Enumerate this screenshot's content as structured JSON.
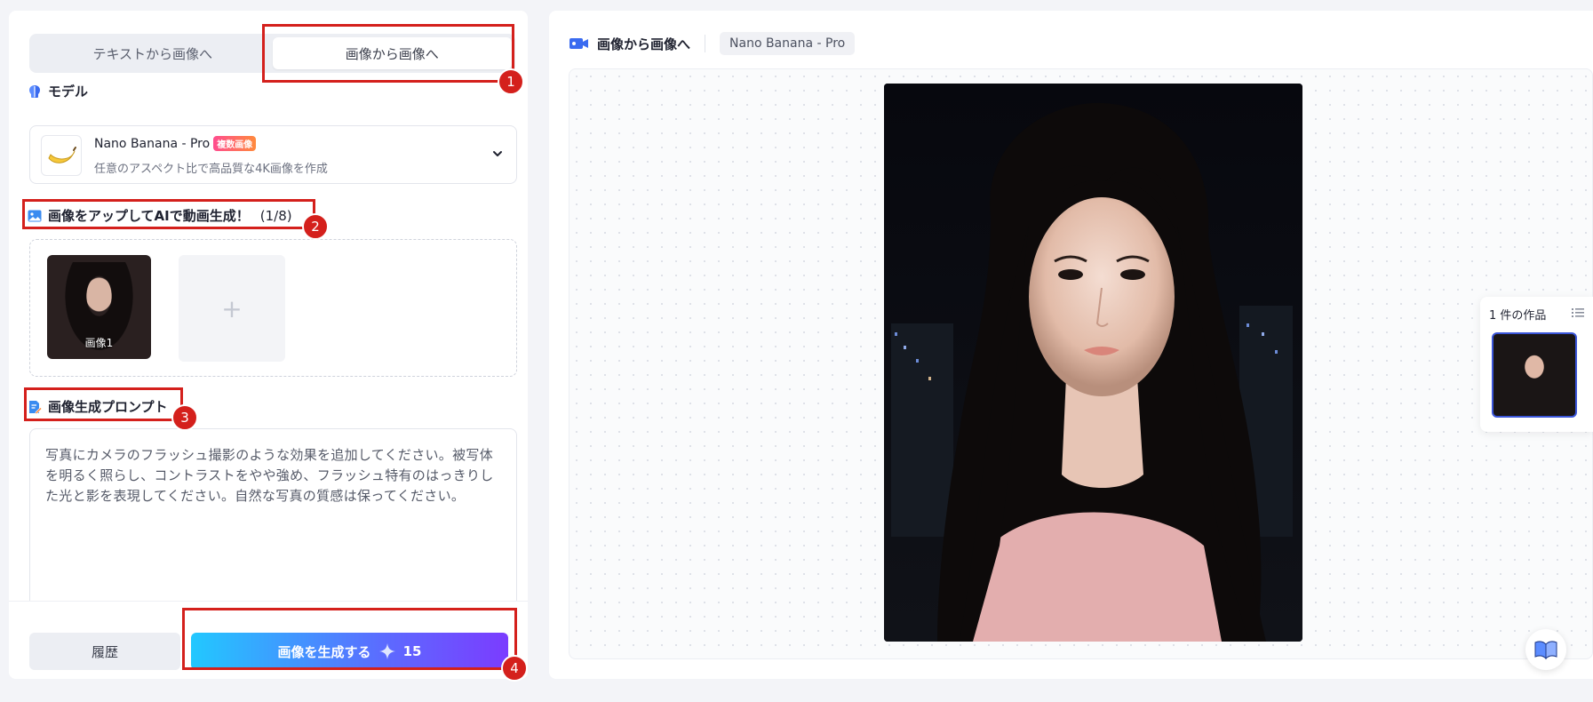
{
  "left": {
    "tabs": [
      "テキストから画像へ",
      "画像から画像へ"
    ],
    "model_section": {
      "title": "モデル",
      "model_name": "Nano Banana - Pro",
      "model_badge": "複数画像",
      "model_desc": "任意のアスペクト比で高品質な4K画像を作成"
    },
    "upload_section": {
      "title": "画像をアップしてAIで動画生成！",
      "count": "(1/8)",
      "image_label": "画像1",
      "add_symbol": "+"
    },
    "prompt_section": {
      "title": "画像生成プロンプト",
      "text": "写真にカメラのフラッシュ撮影のような効果を追加してください。被写体を明るく照らし、コントラストをやや強め、フラッシュ特有のはっきりした光と影を表現してください。自然な写真の質感は保ってください。"
    },
    "history_label": "履歴",
    "generate_label": "画像を生成する",
    "generate_cost": "15"
  },
  "annotations": [
    "1",
    "2",
    "3",
    "4"
  ],
  "right": {
    "title": "画像から画像へ",
    "model_chip": "Nano Banana - Pro",
    "works_title": "1 件の作品"
  },
  "colors": {
    "annotation_red": "#d4201c",
    "accent_blue": "#3a55d8",
    "gen_gradient_start": "#22c8ff",
    "gen_gradient_end": "#7b3cff"
  },
  "icons": {
    "model": "brain-icon",
    "upload": "image-icon",
    "prompt": "edit-doc-icon",
    "header": "video-camera-icon",
    "generate": "sparkle-icon",
    "works": "list-icon",
    "help": "book-icon"
  }
}
